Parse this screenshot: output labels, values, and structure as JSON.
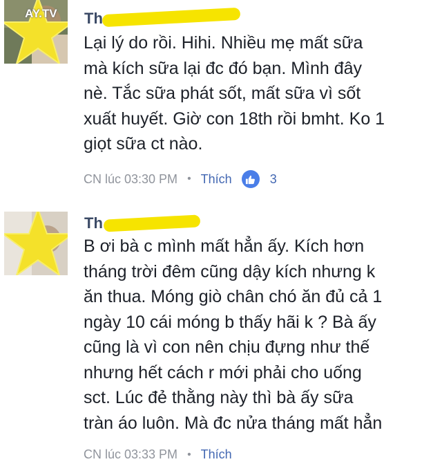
{
  "watermark": "AY.TV",
  "colors": {
    "name": "#3b4a66",
    "body": "#1d2129",
    "meta": "#90949c",
    "link": "#4267b2",
    "like_badge": "#4a7ee8",
    "star": "#f4e12a",
    "scribble": "#f6e400"
  },
  "comments": [
    {
      "author_visible": "Th",
      "text": "Lại lý do rồi. Hihi. Nhiều mẹ mất sữa\nmà kích sữa lại đc đó bạn. Mình đây\nnè. Tắc sữa phát sốt, mất sữa vì sốt\nxuất huyết. Giờ con 18th rồi bmht. Ko 1\ngiọt sữa ct nào.",
      "time": "CN lúc 03:30 PM",
      "separator": "•",
      "like_label": "Thích",
      "like_icon": "thumbs-up-icon",
      "reaction_count": "3"
    },
    {
      "author_visible": "Th",
      "text": "B ơi bà c mình mất hẳn ấy. Kích hơn\ntháng trời đêm cũng dậy kích nhưng k\năn thua. Móng giò chân chó ăn đủ cả 1\nngày 10 cái móng b thấy hãi k ? Bà ấy\ncũng là vì con nên chịu đựng như thế\nnhưng hết cách r mới phải cho uống\nsct. Lúc đẻ thằng này thì bà ấy sữa\ntràn áo luôn. Mà đc nửa tháng mất hẳn",
      "time": "CN lúc 03:33 PM",
      "separator": "•",
      "like_label": "Thích"
    }
  ]
}
